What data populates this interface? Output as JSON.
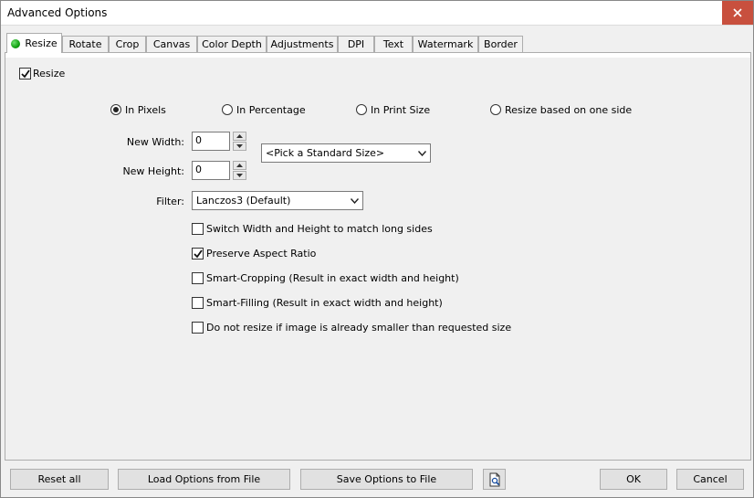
{
  "window": {
    "title": "Advanced Options"
  },
  "tabs": [
    {
      "label": "Resize",
      "active": true
    },
    {
      "label": "Rotate"
    },
    {
      "label": "Crop"
    },
    {
      "label": "Canvas"
    },
    {
      "label": "Color Depth"
    },
    {
      "label": "Adjustments"
    },
    {
      "label": "DPI"
    },
    {
      "label": "Text"
    },
    {
      "label": "Watermark"
    },
    {
      "label": "Border"
    }
  ],
  "resize": {
    "enable_label": "Resize",
    "enabled": true,
    "modes": [
      {
        "label": "In Pixels",
        "selected": true
      },
      {
        "label": "In Percentage",
        "selected": false
      },
      {
        "label": "In Print Size",
        "selected": false
      },
      {
        "label": "Resize based on one side",
        "selected": false
      }
    ],
    "width_label": "New Width:",
    "width_value": "0",
    "height_label": "New Height:",
    "height_value": "0",
    "standard_size": "<Pick a Standard Size>",
    "filter_label": "Filter:",
    "filter_value": "Lanczos3 (Default)",
    "options": [
      {
        "label": "Switch Width and Height to match long sides",
        "checked": false
      },
      {
        "label": "Preserve Aspect Ratio",
        "checked": true
      },
      {
        "label": "Smart-Cropping (Result in exact width and height)",
        "checked": false
      },
      {
        "label": "Smart-Filling (Result in exact width and height)",
        "checked": false
      },
      {
        "label": "Do not resize if image is already smaller than requested size",
        "checked": false
      }
    ]
  },
  "footer": {
    "reset_label": "Reset all",
    "load_label": "Load Options from File",
    "save_label": "Save Options to File",
    "preview_icon": "preview-icon",
    "ok_label": "OK",
    "cancel_label": "Cancel"
  },
  "colors": {
    "close_button": "#c8503e",
    "active_indicator": "#11a011"
  }
}
